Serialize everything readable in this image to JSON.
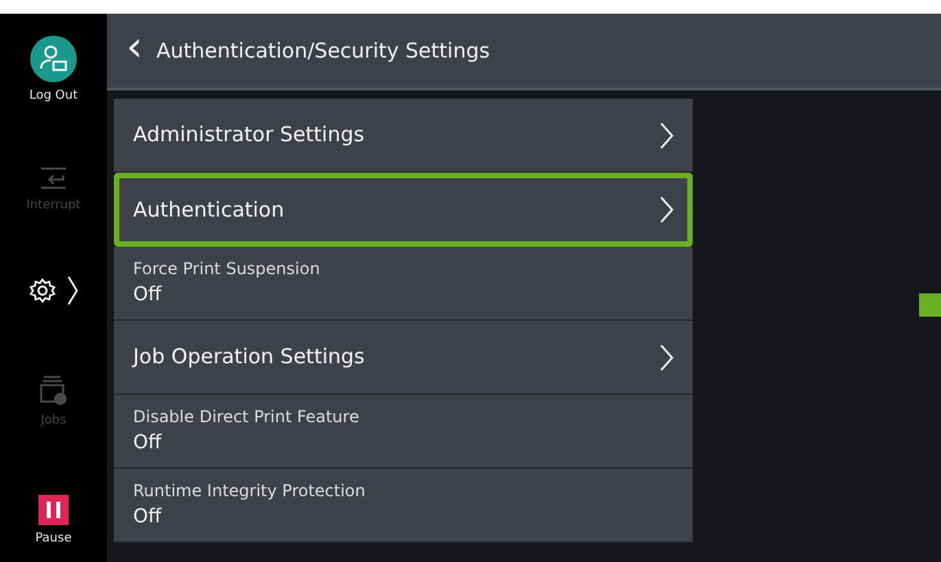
{
  "sidebar": {
    "items": [
      {
        "kind": "logout",
        "label": "Log Out",
        "disabled": false
      },
      {
        "kind": "interrupt",
        "label": "Interrupt",
        "disabled": true
      },
      {
        "kind": "settings",
        "disabled": false
      },
      {
        "kind": "jobs",
        "label": "Jobs",
        "disabled": true
      },
      {
        "kind": "pause",
        "label": "Pause",
        "disabled": false
      }
    ]
  },
  "header": {
    "back": "‹",
    "title": "Authentication/Security Settings"
  },
  "settings": [
    {
      "kind": "nav",
      "label": "Administrator Settings",
      "selected": false
    },
    {
      "kind": "nav",
      "label": "Authentication",
      "selected": true
    },
    {
      "kind": "value",
      "label": "Force Print Suspension",
      "value": "Off",
      "selected": false
    },
    {
      "kind": "nav",
      "label": "Job Operation Settings",
      "selected": false
    },
    {
      "kind": "value",
      "label": "Disable Direct Print Feature",
      "value": "Off",
      "selected": false
    },
    {
      "kind": "value",
      "label": "Runtime Integrity Protection",
      "value": "Off",
      "selected": false
    }
  ]
}
